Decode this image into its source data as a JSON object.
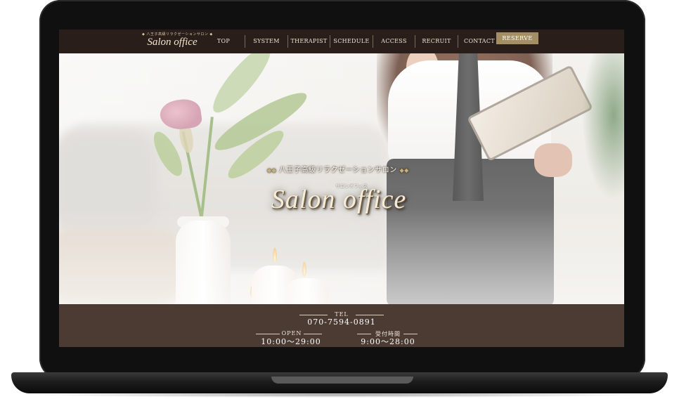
{
  "site": {
    "logo_tagline": "八王子高級リラクゼーションサロン",
    "logo_text": "Salon office"
  },
  "nav": {
    "items": [
      {
        "label": "TOP"
      },
      {
        "label": "SYSTEM"
      },
      {
        "label": "THERAPIST"
      },
      {
        "label": "SCHEDULE"
      },
      {
        "label": "ACCESS"
      },
      {
        "label": "RECRUIT"
      },
      {
        "label": "CONTACT"
      }
    ],
    "reserve_label": "RESERVE"
  },
  "hero": {
    "tagline": "八王子高級リラクゼーションサロン",
    "ruby": "サロンオフィス",
    "title": "Salon office"
  },
  "info": {
    "tel_label": "TEL",
    "tel_value": "070-7594-0891",
    "open_label": "OPEN",
    "open_value": "10:00〜29:00",
    "reception_label": "受付時間",
    "reception_value": "9:00〜28:00"
  },
  "colors": {
    "topbar": "#2a1e1a",
    "reserve": "#a48f64",
    "infobar": "#4b3b33"
  }
}
